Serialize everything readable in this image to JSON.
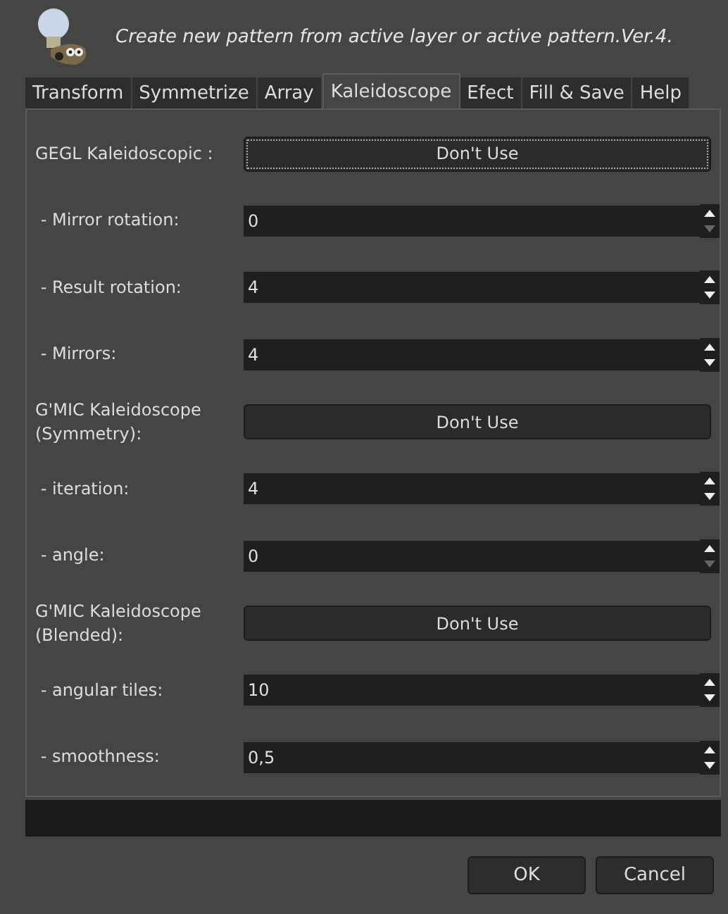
{
  "header": {
    "title": "Create new pattern from active layer or active pattern.Ver.4."
  },
  "tabs": [
    {
      "label": "Transform",
      "selected": false
    },
    {
      "label": "Symmetrize",
      "selected": false
    },
    {
      "label": "Array",
      "selected": false
    },
    {
      "label": "Kaleidoscope",
      "selected": true
    },
    {
      "label": "Efect",
      "selected": false
    },
    {
      "label": "Fill & Save",
      "selected": false
    },
    {
      "label": "Help",
      "selected": false
    }
  ],
  "rows": [
    {
      "kind": "button",
      "label": "GEGL Kaleidoscopic :",
      "value": "Don't Use",
      "focused": true
    },
    {
      "kind": "spin",
      "label": " - Mirror rotation:",
      "value": "0",
      "down_disabled": true
    },
    {
      "kind": "spin",
      "label": " - Result rotation:",
      "value": "4",
      "down_disabled": false
    },
    {
      "kind": "spin",
      "label": " - Mirrors:",
      "value": "4",
      "down_disabled": false
    },
    {
      "kind": "button",
      "label": "G'MIC Kaleidoscope (Symmetry):",
      "value": "Don't Use",
      "focused": false
    },
    {
      "kind": "spin",
      "label": " - iteration:",
      "value": "4",
      "down_disabled": false
    },
    {
      "kind": "spin",
      "label": " - angle:",
      "value": "0",
      "down_disabled": true
    },
    {
      "kind": "button",
      "label": "G'MIC Kaleidoscope (Blended):",
      "value": "Don't Use",
      "focused": false
    },
    {
      "kind": "spin",
      "label": " - angular tiles:",
      "value": "10",
      "down_disabled": false
    },
    {
      "kind": "spin",
      "label": " - smoothness:",
      "value": "0,5",
      "down_disabled": false
    }
  ],
  "progress": {
    "level": 0
  },
  "buttons": [
    "OK",
    "Cancel"
  ]
}
